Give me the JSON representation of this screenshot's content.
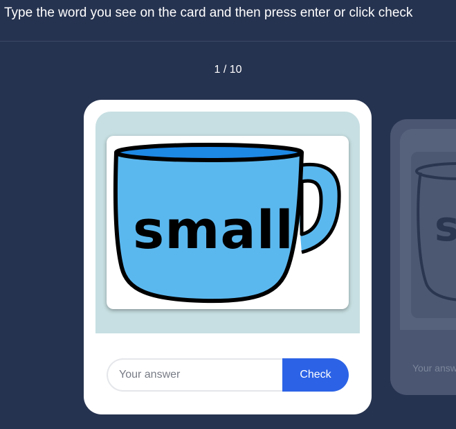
{
  "instruction": "Type the word you see on the card and then press enter or click check",
  "progress": {
    "label": "1 / 10",
    "current": 1,
    "total": 10
  },
  "card": {
    "image_word": "small",
    "image_icon": "cup-icon",
    "answer_placeholder": "Your answer",
    "check_label": "Check"
  },
  "next_card": {
    "image_word": "s",
    "answer_placeholder": "Your answ"
  },
  "colors": {
    "background": "#263350",
    "card": "#ffffff",
    "image_panel": "#c7dfe2",
    "cup_fill": "#5bb8ef",
    "cup_rim": "#1e88e5",
    "check_button": "#2c63e6"
  }
}
